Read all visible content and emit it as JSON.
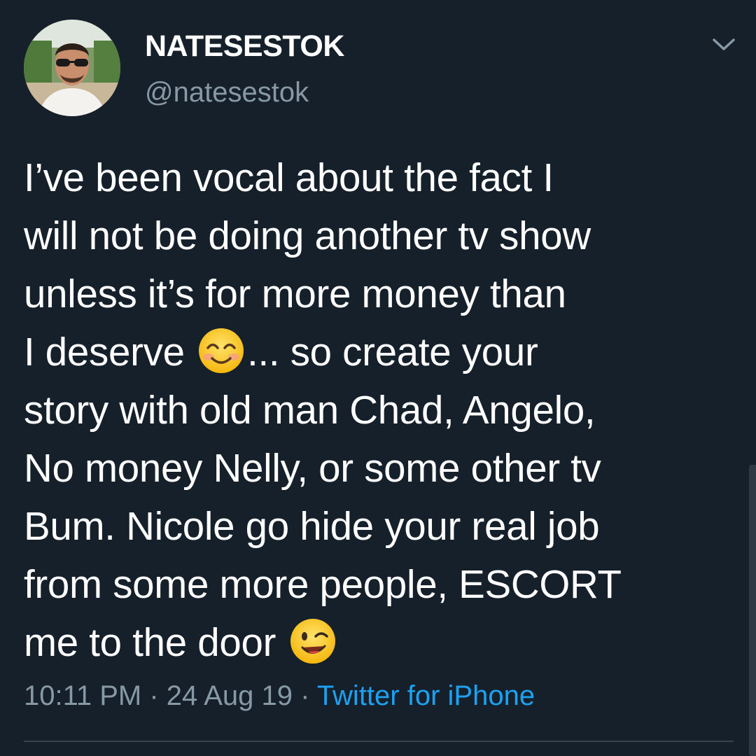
{
  "user": {
    "display_name": "NATESESTOK",
    "handle": "@natesestok",
    "avatar_icon": "profile-photo"
  },
  "tweet": {
    "lines": [
      "I’ve been vocal about the fact I",
      "will not be doing another tv show",
      "unless it’s for more money than",
      "I  deserve",
      "... so create your",
      "story with old man Chad, Angelo,",
      "No money Nelly, or some other tv",
      "Bum. Nicole go hide your real job",
      "from some more people, ESCORT",
      "me to the door"
    ],
    "emojis": [
      "smiling-face-with-smiling-eyes-emoji",
      "winking-face-emoji"
    ]
  },
  "meta": {
    "time": "10:11 PM",
    "sep1": " · ",
    "date": "24 Aug 19",
    "sep2": " · ",
    "source": "Twitter for iPhone"
  },
  "colors": {
    "background": "#15202b",
    "secondary_text": "#8899a6",
    "link": "#1da1f2",
    "divider": "#38444d"
  },
  "icons": {
    "menu": "chevron-down-icon"
  }
}
